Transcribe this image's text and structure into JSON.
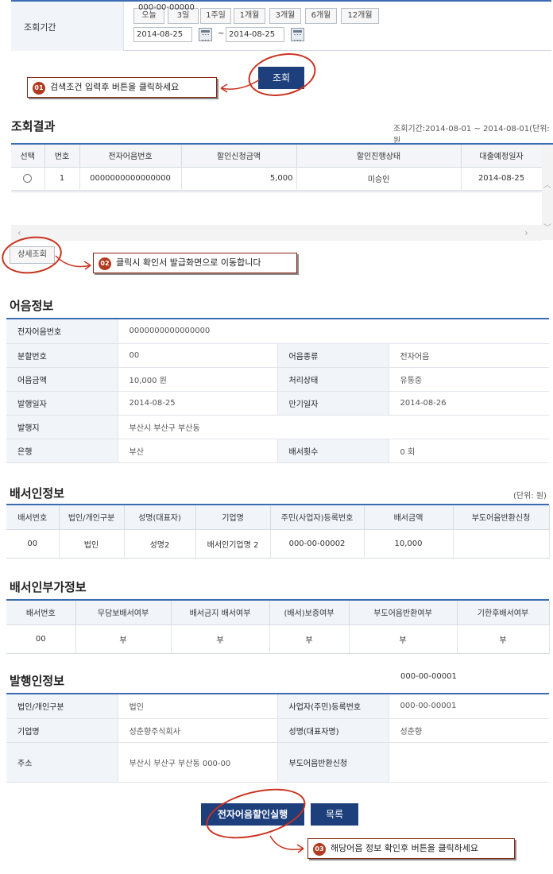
{
  "search": {
    "label": "조회기간",
    "period_buttons": [
      "오늘",
      "3일",
      "1주일",
      "1개월",
      "3개월",
      "6개월",
      "12개월"
    ],
    "overlay_text": "000-00-00000",
    "date_from": "2014-08-25",
    "date_to": "2014-08-25",
    "tilde": "~",
    "search_button": "조회"
  },
  "callouts": {
    "c1_num": "01",
    "c1_text": "검색조건 입력후  버튼을 클릭하세요",
    "c2_num": "02",
    "c2_text": "클릭시 확인서 발급화면으로 이동합니다",
    "c3_num": "03",
    "c3_text": "해당어음 정보 확인후 버튼을 클릭하세요"
  },
  "results": {
    "title": "조회결과",
    "range": "조회기간:2014-08-01 ~ 2014-08-01(단위:원",
    "headers": [
      "선택",
      "번호",
      "전자어음번호",
      "할인신청금액",
      "할인진행상태",
      "대출예정일자"
    ],
    "rows": [
      {
        "no": "1",
        "bill_no": "0000000000000000",
        "amount": "5,000",
        "status": "미승인",
        "date": "2014-08-25"
      }
    ],
    "detail_button": "상세조회"
  },
  "bill_info": {
    "title": "어음정보",
    "bill_no_label": "전자어음번호",
    "bill_no": "0000000000000000",
    "split_label": "분할번호",
    "split": "00",
    "type_label": "어음종류",
    "type": "전자어음",
    "amount_label": "어음금액",
    "amount": "10,000 원",
    "proc_label": "처리상태",
    "proc": "유통중",
    "issue_date_label": "발행일자",
    "issue_date": "2014-08-25",
    "due_date_label": "만기일자",
    "due_date": "2014-08-26",
    "issue_place_label": "발행지",
    "issue_place": "부산시 부산구 부산동",
    "bank_label": "은행",
    "bank": "부산",
    "endorse_count_label": "배서횟수",
    "endorse_count": "0 회"
  },
  "endorser": {
    "title": "배서인정보",
    "unit": "(단위: 원)",
    "headers": [
      "배서번호",
      "법인/개인구분",
      "성명(대표자)",
      "기업명",
      "주민(사업자)등록번호",
      "배서금액",
      "부도어음반환신청"
    ],
    "rows": [
      {
        "no": "00",
        "kind": "법인",
        "name": "성명2",
        "company": "배서인기업명 2",
        "reg": "000-00-00002",
        "amount": "10,000",
        "return": ""
      }
    ]
  },
  "endorser_extra": {
    "title": "배서인부가정보",
    "headers": [
      "배서번호",
      "무담보배서여부",
      "배서금지 배서여부",
      "(배서)보증여부",
      "부도어음반환여부",
      "기한후배서여부"
    ],
    "rows": [
      {
        "no": "00",
        "c1": "부",
        "c2": "부",
        "c3": "부",
        "c4": "부",
        "c5": "부"
      }
    ]
  },
  "issuer": {
    "title": "발행인정보",
    "floating_reg": "000-00-00001",
    "kind_label": "법인/개인구분",
    "kind": "법인",
    "reg_label": "사업자(주민)등록번호",
    "reg": "000-00-00001",
    "company_label": "기업명",
    "company": "성춘향주식회사",
    "name_label": "성명(대표자명)",
    "name": "성춘향",
    "addr_label": "주소",
    "addr": "부산시 부산구 부산동  000-00",
    "return_label": "부도어음반환신청",
    "return": ""
  },
  "actions": {
    "execute": "전자어음할인실행",
    "list": "목록"
  },
  "colors": {
    "accent": "#3b6bb0",
    "button": "#1d3f7c",
    "annotation": "#c8321e"
  }
}
